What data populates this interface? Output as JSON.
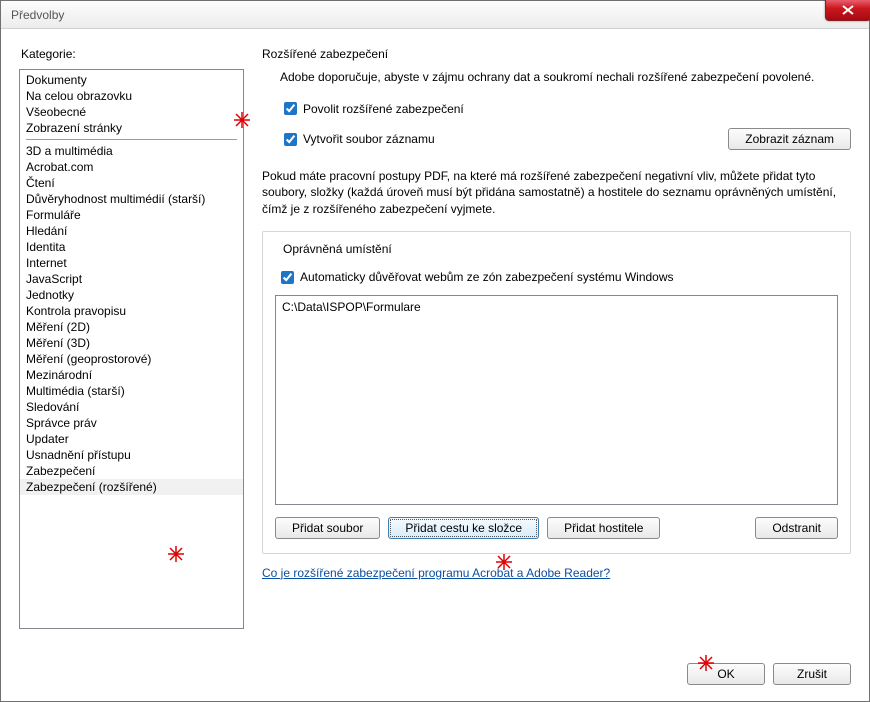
{
  "window": {
    "title": "Předvolby"
  },
  "sidebar": {
    "label": "Kategorie:",
    "group1": [
      "Dokumenty",
      "Na celou obrazovku",
      "Všeobecné",
      "Zobrazení stránky"
    ],
    "group2": [
      "3D a multimédia",
      "Acrobat.com",
      "Čtení",
      "Důvěryhodnost multimédií (starší)",
      "Formuláře",
      "Hledání",
      "Identita",
      "Internet",
      "JavaScript",
      "Jednotky",
      "Kontrola pravopisu",
      "Měření (2D)",
      "Měření (3D)",
      "Měření (geoprostorové)",
      "Mezinárodní",
      "Multimédia (starší)",
      "Sledování",
      "Správce práv",
      "Updater",
      "Usnadnění přístupu",
      "Zabezpečení",
      "Zabezpečení (rozšířené)"
    ],
    "selected": "Zabezpečení (rozšířené)"
  },
  "main": {
    "title": "Rozšířené zabezpečení",
    "intro": "Adobe doporučuje, abyste v zájmu ochrany dat a soukromí nechali rozšířené zabezpečení povolené.",
    "cb_enable": "Povolit rozšířené zabezpečení",
    "cb_log": "Vytvořit soubor záznamu",
    "btn_showlog": "Zobrazit záznam",
    "para": "Pokud máte pracovní postupy PDF, na které má rozšířené zabezpečení negativní vliv, můžete přidat tyto soubory, složky (každá úroveň musí být přidána samostatně) a hostitele do seznamu oprávněných umístění, čímž je z rozšířeného zabezpečení vyjmete.",
    "privileged": {
      "legend": "Oprávněná umístění",
      "cb_trust": "Automaticky důvěřovat webům ze zón zabezpečení systému Windows",
      "items": [
        "C:\\Data\\ISPOP\\Formulare"
      ],
      "btn_add_file": "Přidat soubor",
      "btn_add_folder": "Přidat cestu ke složce",
      "btn_add_host": "Přidat hostitele",
      "btn_remove": "Odstranit"
    },
    "help_link": "Co je rozšířené zabezpečení programu Acrobat a Adobe Reader?"
  },
  "footer": {
    "ok": "OK",
    "cancel": "Zrušit"
  }
}
